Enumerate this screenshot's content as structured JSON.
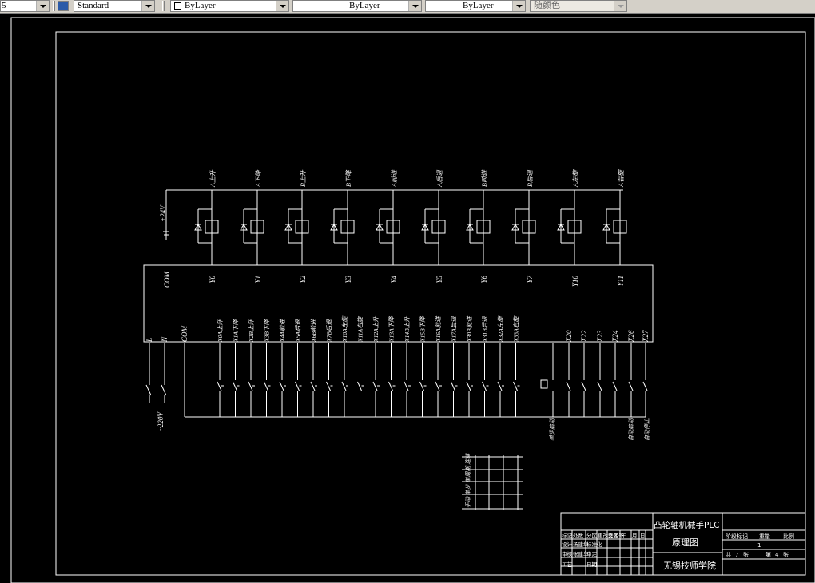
{
  "toolbar": {
    "layer_value": "5",
    "textstyle_value": "Standard",
    "color_value": "ByLayer",
    "linetype_value": "ByLayer",
    "lineweight_value": "ByLayer",
    "plotstyle_value": "随颜色"
  },
  "drawing": {
    "supply_top": "+24V",
    "com_out": "COM",
    "supply_bottom": "~220V",
    "l_label": "L",
    "n_label": "N",
    "com_in": "COM",
    "outputs": [
      {
        "addr": "Y0",
        "desc": "A上升"
      },
      {
        "addr": "Y1",
        "desc": "A下降"
      },
      {
        "addr": "Y2",
        "desc": "B上升"
      },
      {
        "addr": "Y3",
        "desc": "B下降"
      },
      {
        "addr": "Y4",
        "desc": "A前进"
      },
      {
        "addr": "Y5",
        "desc": "A后退"
      },
      {
        "addr": "Y6",
        "desc": "B前进"
      },
      {
        "addr": "Y7",
        "desc": "B后退"
      },
      {
        "addr": "Y10",
        "desc": "A左旋"
      },
      {
        "addr": "Y11",
        "desc": "A右旋"
      }
    ],
    "inputs": [
      "X0A上升",
      "X1A下降",
      "X2B上升",
      "X3B下降",
      "X4A前进",
      "X5A后退",
      "X6B前进",
      "X7B后退",
      "X10A左旋",
      "X11A右旋",
      "X12A上升",
      "X13A下降",
      "X14B上升",
      "X15B下降",
      "X16A前进",
      "X17A后退",
      "X30B前进",
      "X31B后退",
      "X32A左旋",
      "X33A右旋"
    ],
    "inputs2": [
      "X20",
      "X22",
      "X23",
      "X24",
      "X26",
      "X27"
    ],
    "inputs2_notes": [
      "手动",
      "自动"
    ],
    "bottom_labels": [
      "单步启动",
      "自动启动",
      "自动停止"
    ],
    "small_table_label": "手动 单步 单周期 连续"
  },
  "title_block": {
    "title_line1": "凸轮轴机械手PLC",
    "title_line2": "原理图",
    "school": "无锡技师学院",
    "left_rows": [
      [
        "标记",
        "处数",
        "分区",
        "更改文件号",
        "签名",
        "年",
        "月",
        "日"
      ],
      [
        "设计",
        "汤建华",
        "标准化"
      ],
      [
        "审核",
        "张建华",
        "审定"
      ],
      [
        "工艺",
        "",
        "日期"
      ]
    ],
    "right_head": [
      "阶段标记",
      "重量",
      "比例"
    ],
    "right_vals": [
      "1"
    ],
    "sheet": [
      "共",
      "7",
      "张",
      "第",
      "4",
      "张"
    ]
  }
}
